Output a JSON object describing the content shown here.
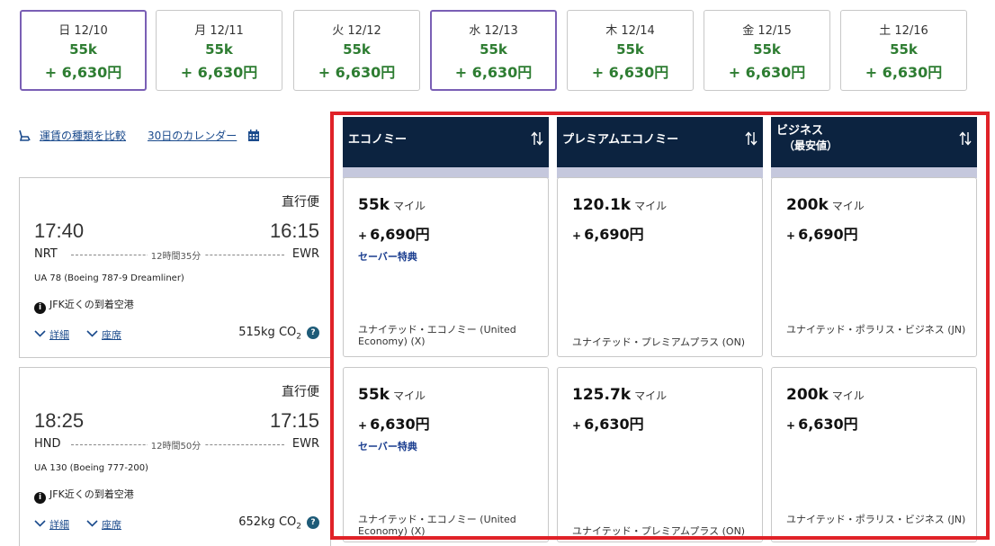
{
  "dates": [
    {
      "day": "日 12/10",
      "miles": "55k",
      "price": "+ 6,630円",
      "selected": true
    },
    {
      "day": "月 12/11",
      "miles": "55k",
      "price": "+ 6,630円",
      "selected": false
    },
    {
      "day": "火 12/12",
      "miles": "55k",
      "price": "+ 6,630円",
      "selected": false
    },
    {
      "day": "水 12/13",
      "miles": "55k",
      "price": "+ 6,630円",
      "selected": true
    },
    {
      "day": "木 12/14",
      "miles": "55k",
      "price": "+ 6,630円",
      "selected": false
    },
    {
      "day": "金 12/15",
      "miles": "55k",
      "price": "+ 6,630円",
      "selected": false
    },
    {
      "day": "土 12/16",
      "miles": "55k",
      "price": "+ 6,630円",
      "selected": false
    }
  ],
  "tools": {
    "compare_label": "運賃の種類を比較",
    "calendar_label": "30日のカレンダー"
  },
  "cabins": [
    {
      "label": "エコノミー",
      "label2": ""
    },
    {
      "label": "プレミアムエコノミー",
      "label2": ""
    },
    {
      "label": "ビジネス",
      "label2": "（最安値）"
    }
  ],
  "flights": [
    {
      "type": "直行便",
      "dep_time": "17:40",
      "arr_time": "16:15",
      "origin": "NRT",
      "dest": "EWR",
      "duration": "12時間35分",
      "equipment": "UA 78 (Boeing 787-9 Dreamliner)",
      "info": "JFK近くの到着空港",
      "info_icon": "i",
      "details_label": "詳細",
      "seats_label": "座席",
      "co2": "515kg CO",
      "co2_sub": "2",
      "help_icon": "?",
      "fares": [
        {
          "miles": "55k",
          "miles_unit": "マイル",
          "plus": "+",
          "tax": "6,690円",
          "saver": "セーバー特典",
          "product": "ユナイテッド・エコノミー (United Economy) (X)"
        },
        {
          "miles": "120.1k",
          "miles_unit": "マイル",
          "plus": "+",
          "tax": "6,690円",
          "saver": "",
          "product": "ユナイテッド・プレミアムプラス (ON)"
        },
        {
          "miles": "200k",
          "miles_unit": "マイル",
          "plus": "+",
          "tax": "6,690円",
          "saver": "",
          "product": "ユナイテッド・ポラリス・ビジネス (JN)"
        }
      ]
    },
    {
      "type": "直行便",
      "dep_time": "18:25",
      "arr_time": "17:15",
      "origin": "HND",
      "dest": "EWR",
      "duration": "12時間50分",
      "equipment": "UA 130 (Boeing 777-200)",
      "info": "JFK近くの到着空港",
      "info_icon": "i",
      "details_label": "詳細",
      "seats_label": "座席",
      "co2": "652kg CO",
      "co2_sub": "2",
      "help_icon": "?",
      "fares": [
        {
          "miles": "55k",
          "miles_unit": "マイル",
          "plus": "+",
          "tax": "6,630円",
          "saver": "セーバー特典",
          "product": "ユナイテッド・エコノミー (United Economy) (X)"
        },
        {
          "miles": "125.7k",
          "miles_unit": "マイル",
          "plus": "+",
          "tax": "6,630円",
          "saver": "",
          "product": "ユナイテッド・プレミアムプラス (ON)"
        },
        {
          "miles": "200k",
          "miles_unit": "マイル",
          "plus": "+",
          "tax": "6,630円",
          "saver": "",
          "product": "ユナイテッド・ポラリス・ビジネス (JN)"
        }
      ]
    }
  ],
  "colors": {
    "header_navy": "#0c2340",
    "price_green": "#2e7d32",
    "selected_border": "#7a5fb5",
    "highlight_red": "#e02228",
    "link_blue": "#1a4a8c"
  }
}
